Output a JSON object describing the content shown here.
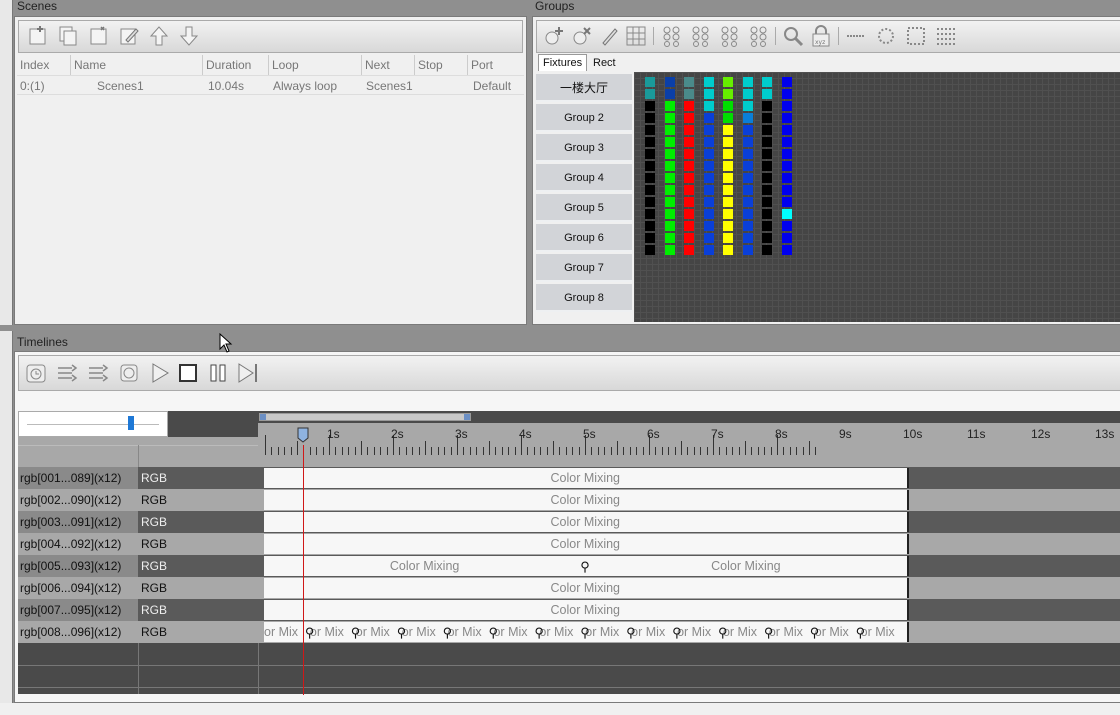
{
  "scenes": {
    "title": "Scenes",
    "columns": [
      "Index",
      "Name",
      "Duration",
      "Loop",
      "Next",
      "Stop",
      "Port"
    ],
    "rows": [
      {
        "index": "0:(1)",
        "name": "Scenes1",
        "duration": "10.04s",
        "loop": "Always loop",
        "next": "Scenes1",
        "stop": "",
        "port": "Default"
      }
    ]
  },
  "groups": {
    "title": "Groups",
    "tabs": [
      "Fixtures",
      "Rect"
    ],
    "items": [
      "一楼大厅",
      "Group 2",
      "Group 3",
      "Group 4",
      "Group 5",
      "Group 6",
      "Group 7",
      "Group 8"
    ],
    "fixture_columns": [
      [
        "#1a9a9a",
        "#1a9a9a",
        "#000000",
        "#000000",
        "#000000",
        "#000000",
        "#000000",
        "#000000",
        "#000000",
        "#000000",
        "#000000",
        "#000000",
        "#000000",
        "#000000",
        "#000000"
      ],
      [
        "#0a3fa8",
        "#0a3fa8",
        "#00ee00",
        "#00ee00",
        "#00ee00",
        "#00ee00",
        "#00ee00",
        "#00ee00",
        "#00ee00",
        "#00ee00",
        "#00ee00",
        "#00ee00",
        "#00ee00",
        "#00ee00",
        "#00ee00"
      ],
      [
        "#4a8a8a",
        "#4a8a8a",
        "#ff0000",
        "#ff0000",
        "#ff0000",
        "#ff0000",
        "#ff0000",
        "#ff0000",
        "#ff0000",
        "#ff0000",
        "#ff0000",
        "#ff0000",
        "#ff0000",
        "#ff0000",
        "#ff0000"
      ],
      [
        "#00cccc",
        "#00cccc",
        "#00cccc",
        "#0a3fd8",
        "#0a3fd8",
        "#0a3fd8",
        "#0a3fd8",
        "#0a3fd8",
        "#0a3fd8",
        "#0a3fd8",
        "#0a3fd8",
        "#0a3fd8",
        "#0a3fd8",
        "#0a3fd8",
        "#0a3fd8"
      ],
      [
        "#66ee00",
        "#66ee00",
        "#00dd00",
        "#00dd00",
        "#ffff00",
        "#ffff00",
        "#ffff00",
        "#ffff00",
        "#ffff00",
        "#ffff00",
        "#ffff00",
        "#ffff00",
        "#ffff00",
        "#ffff00",
        "#ffff00"
      ],
      [
        "#00cccc",
        "#00cccc",
        "#00cccc",
        "#0a7fd8",
        "#0a3fd8",
        "#0a3fd8",
        "#0a3fd8",
        "#0a3fd8",
        "#0a3fd8",
        "#0a3fd8",
        "#0a3fd8",
        "#0a3fd8",
        "#0a3fd8",
        "#0a3fd8",
        "#0a3fd8"
      ],
      [
        "#00cccc",
        "#00cccc",
        "#000000",
        "#000000",
        "#000000",
        "#000000",
        "#000000",
        "#000000",
        "#000000",
        "#000000",
        "#000000",
        "#000000",
        "#000000",
        "#000000",
        "#000000"
      ],
      [
        "#0000ee",
        "#0000ee",
        "#0000ee",
        "#0000ee",
        "#0000ee",
        "#0000ee",
        "#0000ee",
        "#0000ee",
        "#0000ee",
        "#0000ee",
        "#0000ee",
        "#00ffff",
        "#0000ee",
        "#0000ee",
        "#0000ee"
      ]
    ]
  },
  "timelines": {
    "title": "Timelines",
    "ruler_labels": [
      "1s",
      "2s",
      "3s",
      "4s",
      "5s",
      "6s",
      "7s",
      "8s",
      "9s",
      "10s",
      "11s",
      "12s",
      "13s"
    ],
    "playhead_seconds": 0.6,
    "zoom_fraction": 0.8,
    "tracks": [
      {
        "label": "rgb[001...089](x12)",
        "type": "RGB",
        "clips": [
          "Color Mixing"
        ]
      },
      {
        "label": "rgb[002...090](x12)",
        "type": "RGB",
        "clips": [
          "Color Mixing"
        ]
      },
      {
        "label": "rgb[003...091](x12)",
        "type": "RGB",
        "clips": [
          "Color Mixing"
        ]
      },
      {
        "label": "rgb[004...092](x12)",
        "type": "RGB",
        "clips": [
          "Color Mixing"
        ]
      },
      {
        "label": "rgb[005...093](x12)",
        "type": "RGB",
        "clips": [
          "Color Mixing",
          "Color Mixing"
        ]
      },
      {
        "label": "rgb[006...094](x12)",
        "type": "RGB",
        "clips": [
          "Color Mixing"
        ]
      },
      {
        "label": "rgb[007...095](x12)",
        "type": "RGB",
        "clips": [
          "Color Mixing"
        ]
      },
      {
        "label": "rgb[008...096](x12)",
        "type": "RGB",
        "clips": [
          "or Mix",
          "or Mix",
          "or Mix",
          "or Mix",
          "or Mix",
          "or Mix",
          "or Mix",
          "or Mix",
          "or Mix",
          "or Mix",
          "or Mix",
          "or Mix",
          "or Mix",
          "or Mix"
        ]
      }
    ]
  }
}
